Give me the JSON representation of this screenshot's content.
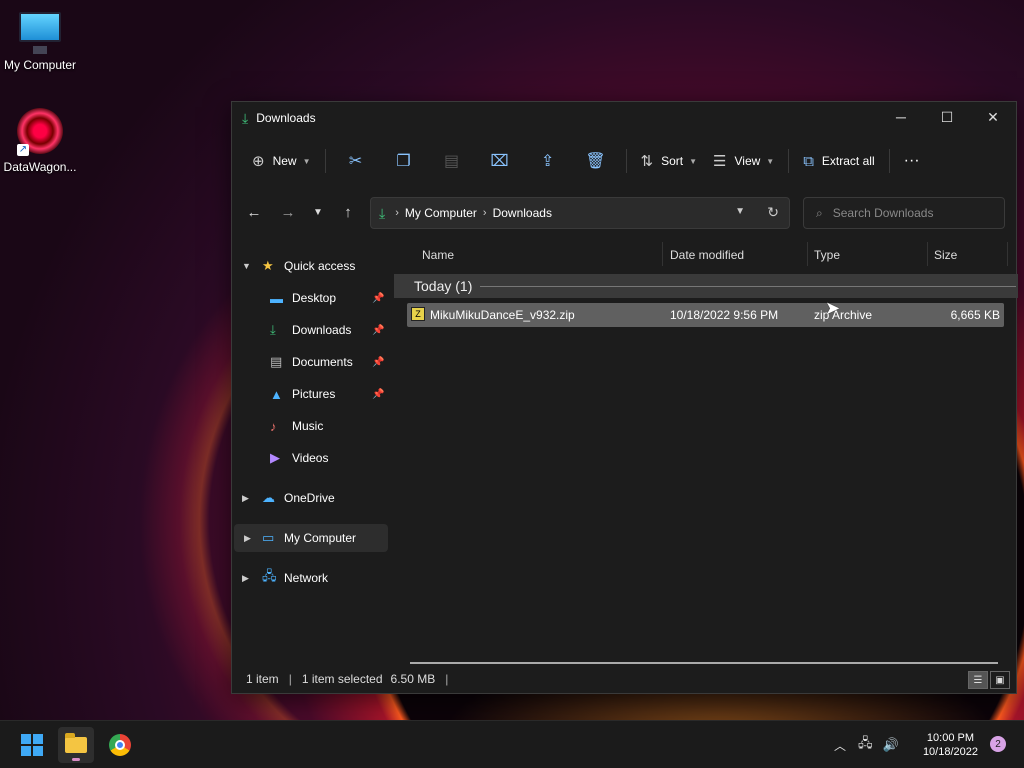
{
  "desktop": {
    "icons": [
      {
        "label": "My Computer",
        "icon": "monitor-icon"
      },
      {
        "label": "DataWagon...",
        "icon": "datawagon-icon"
      }
    ]
  },
  "window": {
    "title": "Downloads",
    "controls": {
      "minimize": "─",
      "maximize": "☐",
      "close": "✕"
    }
  },
  "toolbar": {
    "new_label": "New",
    "sort_label": "Sort",
    "view_label": "View",
    "extract_label": "Extract all",
    "more_label": "···"
  },
  "address": {
    "crumbs": [
      "My Computer",
      "Downloads"
    ],
    "search_placeholder": "Search Downloads"
  },
  "navpane": {
    "quick_access": "Quick access",
    "items": [
      {
        "label": "Desktop",
        "pinned": true
      },
      {
        "label": "Downloads",
        "pinned": true
      },
      {
        "label": "Documents",
        "pinned": true
      },
      {
        "label": "Pictures",
        "pinned": true
      },
      {
        "label": "Music",
        "pinned": false
      },
      {
        "label": "Videos",
        "pinned": false
      }
    ],
    "onedrive": "OneDrive",
    "my_computer": "My Computer",
    "network": "Network"
  },
  "columns": {
    "name": "Name",
    "date": "Date modified",
    "type": "Type",
    "size": "Size"
  },
  "group": {
    "label": "Today (1)"
  },
  "files": [
    {
      "name": "MikuMikuDanceE_v932.zip",
      "date": "10/18/2022 9:56 PM",
      "type": "zip Archive",
      "size": "6,665 KB"
    }
  ],
  "status": {
    "count": "1 item",
    "selected": "1 item selected",
    "size": "6.50 MB"
  },
  "taskbar": {
    "time": "10:00 PM",
    "date": "10/18/2022",
    "notifications": "2"
  },
  "colors": {
    "accent": "#3fa9f5",
    "window_bg": "#1c1c1c",
    "selection": "#606060"
  }
}
